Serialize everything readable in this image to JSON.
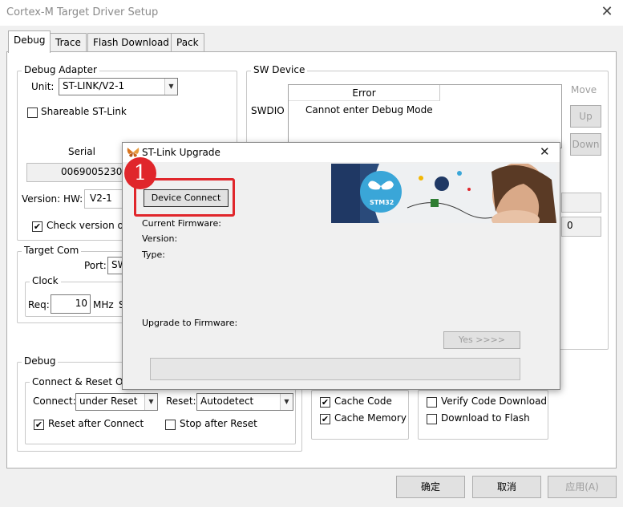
{
  "window": {
    "title": "Cortex-M Target Driver Setup",
    "close_glyph": "✕"
  },
  "tabs": [
    {
      "label": "Debug",
      "active": true
    },
    {
      "label": "Trace",
      "active": false
    },
    {
      "label": "Flash Download",
      "active": false
    },
    {
      "label": "Pack",
      "active": false
    }
  ],
  "debug_adapter": {
    "group_label": "Debug Adapter",
    "unit_label": "Unit:",
    "unit_value": "ST-LINK/V2-1",
    "shareable_label": "Shareable ST-Link",
    "serial_label": "Serial",
    "serial_value": "00690052300",
    "version_label": "Version: HW:",
    "version_value": "V2-1",
    "check_version_label": "Check version o"
  },
  "sw_device": {
    "group_label": "SW Device",
    "swdio_label": "SWDIO",
    "table_header": "Error",
    "table_row": "Cannot enter Debug Mode",
    "move_label": "Move",
    "up_label": "Up",
    "down_label": "Down",
    "extra_value": "0"
  },
  "target_com": {
    "group_label": "Target Com",
    "port_label": "Port:",
    "port_value": "SW",
    "clock_label": "Clock",
    "req_label": "Req:",
    "req_value": "10",
    "req_unit": "MHz",
    "req_suffix": "S"
  },
  "debug": {
    "group_label": "Debug",
    "connect_reset_label": "Connect & Reset O",
    "connect_label": "Connect:",
    "connect_value": "under Reset",
    "reset_label": "Reset:",
    "reset_value": "Autodetect",
    "reset_after_connect": "Reset after Connect",
    "stop_after_reset": "Stop after Reset"
  },
  "cache": {
    "cache_code": "Cache Code",
    "cache_memory": "Cache Memory",
    "verify_code_download": "Verify Code Download",
    "download_to_flash": "Download to Flash"
  },
  "footer": {
    "ok": "确定",
    "cancel": "取消",
    "apply": "应用(A)"
  },
  "dialog": {
    "title": "ST-Link Upgrade",
    "close_glyph": "✕",
    "device_connect": "Device Connect",
    "current_firmware": "Current Firmware:",
    "version": "Version:",
    "type": "Type:",
    "upgrade_to": "Upgrade to Firmware:",
    "yes_button": "Yes >>>>",
    "banner_logo_text": "STM32"
  },
  "annotation": {
    "number": "1",
    "color": "#e0262b"
  },
  "colors": {
    "accent_red": "#e0262b",
    "banner_navy": "#1f3864",
    "banner_blue": "#3aa6d8"
  }
}
